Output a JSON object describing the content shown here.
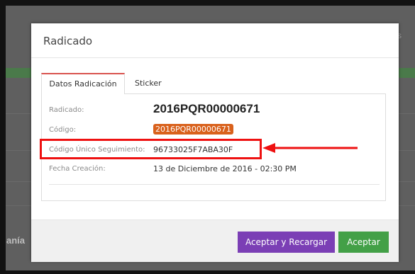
{
  "background": {
    "side_text": "anía",
    "right_char": "s"
  },
  "modal": {
    "title": "Radicado",
    "tabs": [
      {
        "label": "Datos Radicación",
        "active": true
      },
      {
        "label": "Sticker",
        "active": false
      }
    ],
    "fields": {
      "radicado": {
        "label": "Radicado:",
        "value": "2016PQR00000671"
      },
      "codigo": {
        "label": "Código:",
        "value": "2016PQR00000671"
      },
      "seguimiento": {
        "label": "Código Único Seguimiento:",
        "value": "96733025F7ABA30F"
      },
      "fecha": {
        "label": "Fecha Creación:",
        "value": "13 de Diciembre de 2016 - 02:30 PM"
      }
    },
    "buttons": {
      "reload": "Aceptar y Recargar",
      "accept": "Aceptar"
    }
  },
  "colors": {
    "badge": "#d9611c",
    "tab_accent": "#d9534f",
    "button_purple": "#7b3fb5",
    "button_green": "#43a047",
    "annotation": "#ee1111"
  },
  "icons": {
    "annotation_arrow": "arrow-left-icon"
  }
}
